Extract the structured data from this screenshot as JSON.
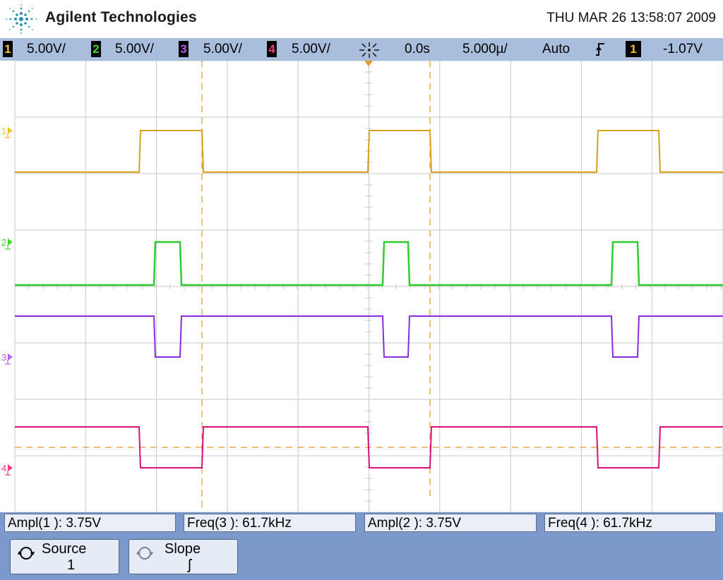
{
  "header": {
    "brand": "Agilent Technologies",
    "datetime": "THU MAR 26 13:58:07 2009",
    "logo_icon": "agilent-spark-logo"
  },
  "status_bar": {
    "channels": [
      {
        "number": "1",
        "scale": "5.00V/",
        "color": "#f3c322"
      },
      {
        "number": "2",
        "scale": "5.00V/",
        "color": "#41d829"
      },
      {
        "number": "3",
        "scale": "5.00V/",
        "color": "#b95cff"
      },
      {
        "number": "4",
        "scale": "5.00V/",
        "color": "#ff3a7c"
      }
    ],
    "trigger_icon": "trigger-spark-icon",
    "time_delay": "0.0s",
    "timebase": "5.000µ/",
    "trigger_mode": "Auto",
    "trigger_slope_icon": "rising-edge-icon",
    "trigger_source": "1",
    "trigger_level": "-1.07V"
  },
  "waveforms": [
    {
      "name": "ch1",
      "color": "#d4a21a",
      "marker_color": "#f3c322",
      "label": "1"
    },
    {
      "name": "ch2",
      "color": "#2fcc2f",
      "marker_color": "#41d829",
      "label": "2"
    },
    {
      "name": "ch3",
      "color": "#8a2be2",
      "marker_color": "#b95cff",
      "label": "3"
    },
    {
      "name": "ch4",
      "color": "#d8117a",
      "marker_color": "#ff3a7c",
      "label": "4"
    }
  ],
  "measurements": [
    {
      "label": "Ampl(1 ): 3.75V"
    },
    {
      "label": "Freq(3 ): 61.7kHz"
    },
    {
      "label": "Ampl(2 ): 3.75V"
    },
    {
      "label": "Freq(4 ): 61.7kHz"
    }
  ],
  "softkeys": [
    {
      "label": "Source",
      "value": "1",
      "icon": "rotate-knob-icon"
    },
    {
      "label": "Slope",
      "value": "ʃ",
      "icon": "rotate-knob-icon"
    }
  ],
  "colors": {
    "status_bar_bg": "#a8bedc",
    "menu_bg": "#7b9acb",
    "grid_line": "#c8c8c8",
    "cursor": "#e69a28"
  }
}
